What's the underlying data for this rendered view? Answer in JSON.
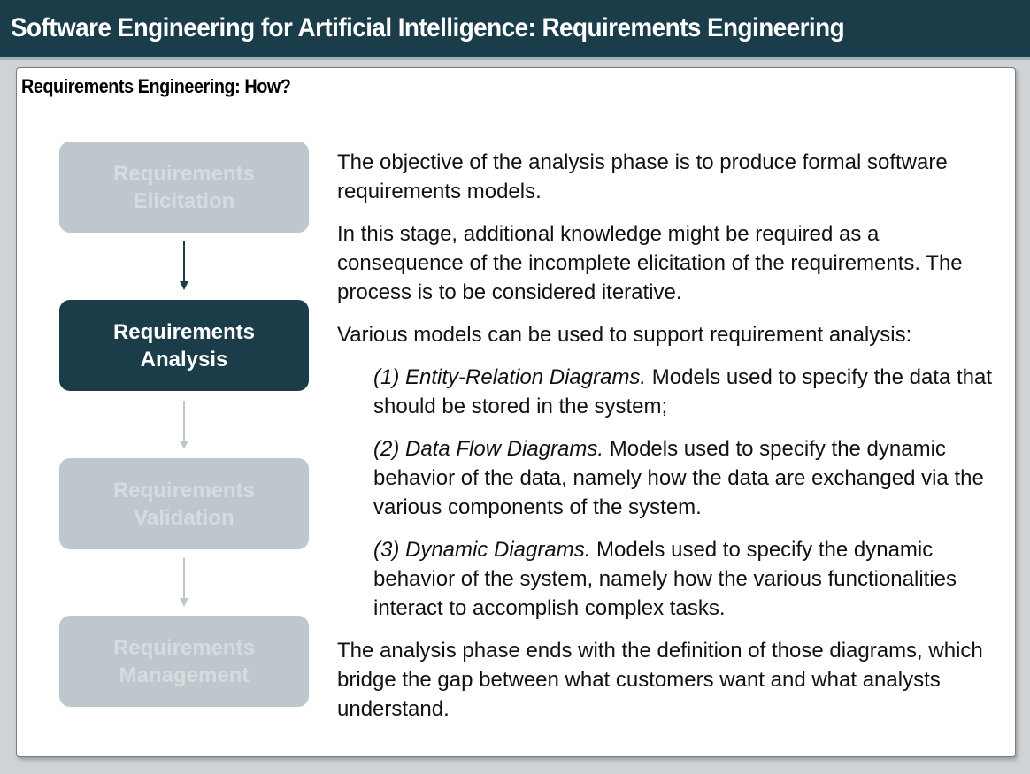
{
  "header": {
    "title": "Software Engineering for Artificial Intelligence: Requirements Engineering"
  },
  "panel": {
    "heading": "Requirements Engineering: How?"
  },
  "flow": {
    "steps": [
      {
        "label": "Requirements\nElicitation",
        "state": "inactive"
      },
      {
        "label": "Requirements\nAnalysis",
        "state": "active"
      },
      {
        "label": "Requirements\nValidation",
        "state": "inactive"
      },
      {
        "label": "Requirements\nManagement",
        "state": "inactive"
      }
    ]
  },
  "content": {
    "intro": "The objective of the analysis phase is to produce formal software requirements models.",
    "stage": "In this stage, additional knowledge might be required as a consequence of the incomplete elicitation of the requirements. The process is to be considered iterative.",
    "models_lead": "Various models can be used to support requirement analysis:",
    "models": [
      {
        "name": "(1) Entity-Relation Diagrams.",
        "desc": " Models used to specify the data that should be stored in the system;"
      },
      {
        "name": "(2) Data Flow Diagrams.",
        "desc": " Models used to specify the dynamic behavior of the data, namely how the data are exchanged via the various components of the system."
      },
      {
        "name": "(3) Dynamic Diagrams.",
        "desc": " Models used to specify the dynamic behavior of the system, namely how the various functionalities interact to accomplish complex tasks."
      }
    ],
    "conclusion": "The analysis phase ends with the definition of those diagrams, which bridge the gap between what customers want and what analysts understand."
  },
  "colors": {
    "header_bg": "#1b3d4a",
    "active_step": "#1b3d4a",
    "inactive_step": "#bec8cc",
    "active_arrow": "#1b3d4a",
    "inactive_arrow": "#bec8cc"
  },
  "icons": {
    "flow_arrows": [
      "arrow-down-icon",
      "arrow-down-icon",
      "arrow-down-icon"
    ]
  }
}
